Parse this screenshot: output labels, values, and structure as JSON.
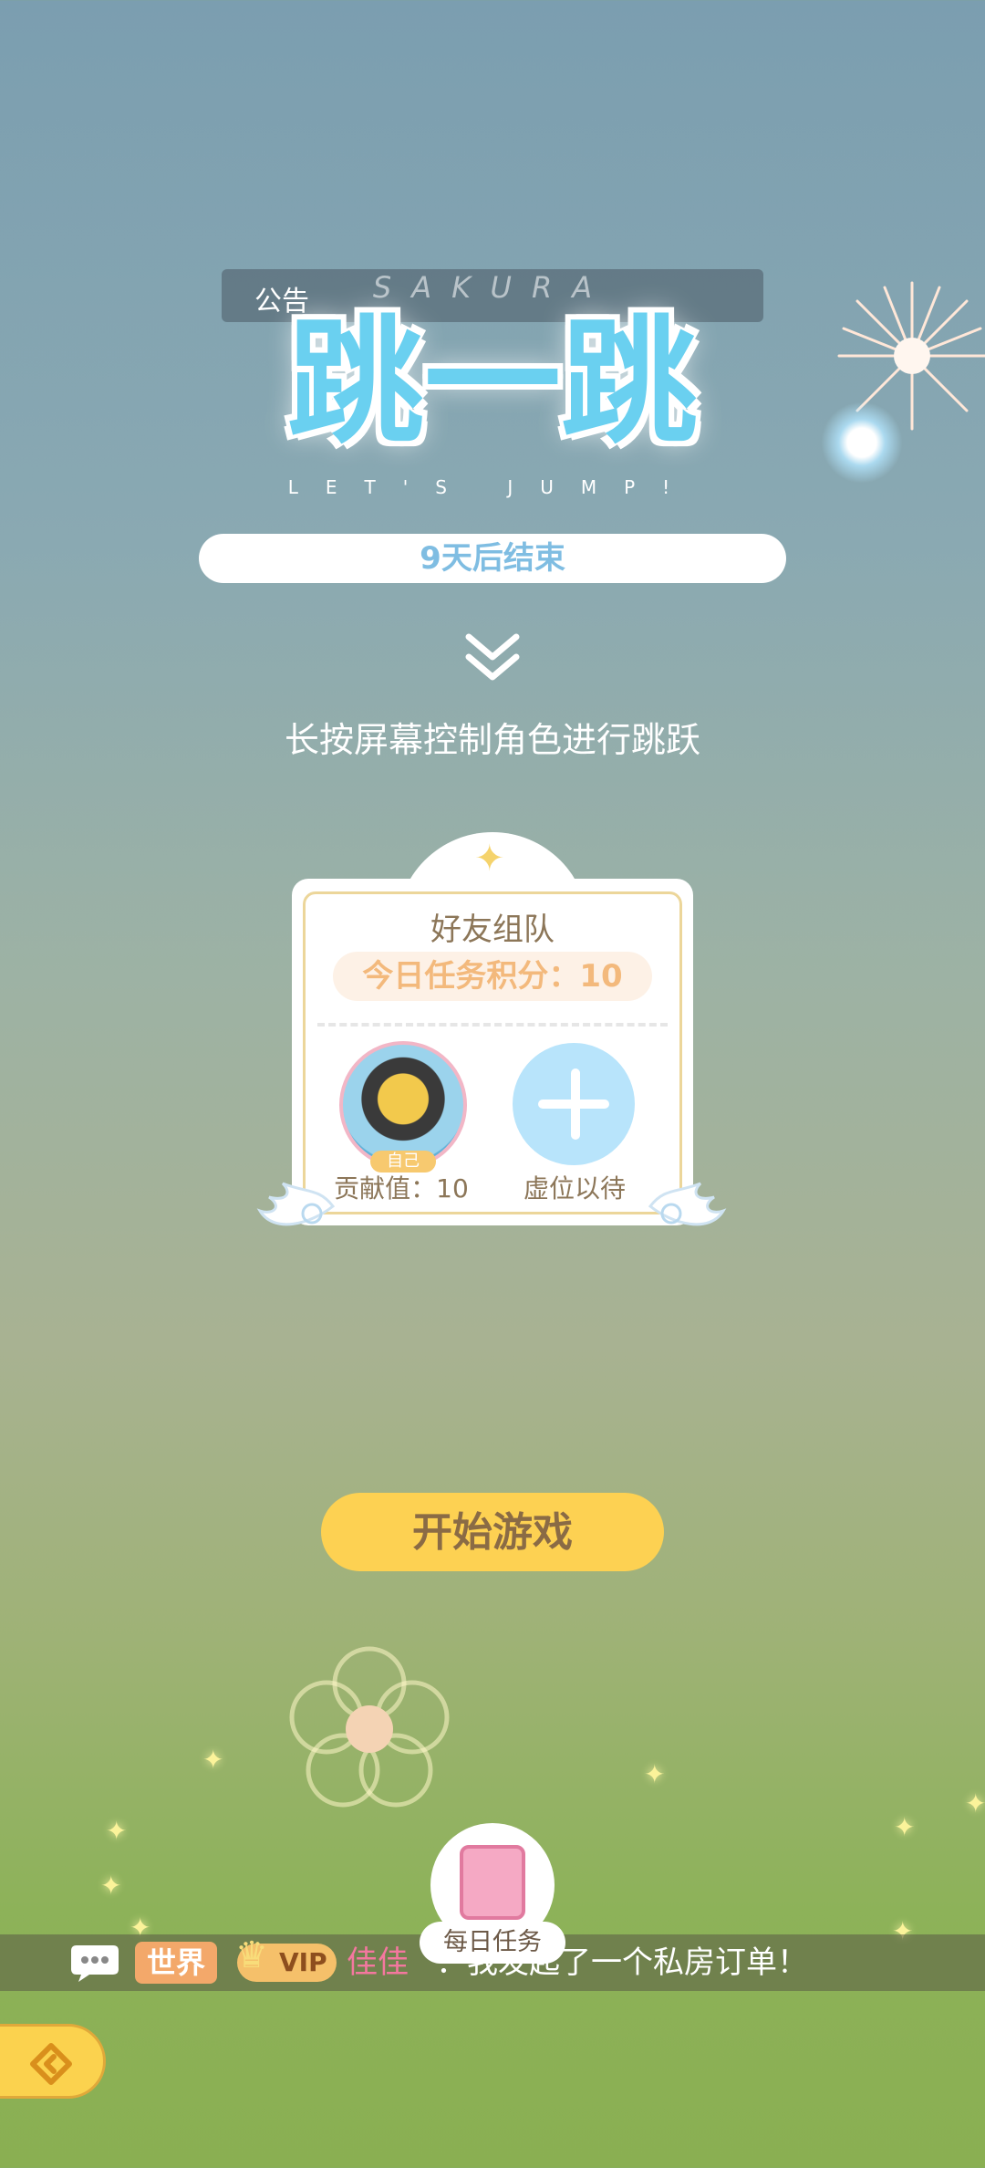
{
  "notice": {
    "label": "公告"
  },
  "logo": {
    "top_text": "SAKURA",
    "title": "跳一跳",
    "subtitle": "LET'S JUMP!"
  },
  "countdown": {
    "text": "9天后结束"
  },
  "hint": "长按屏幕控制角色进行跳跃",
  "team_card": {
    "title": "好友组队",
    "points_text": "今日任务积分：10",
    "self_tag": "自己",
    "self_contribution": "贡献值：10",
    "slot_waiting": "虚位以待"
  },
  "start_button": "开始游戏",
  "daily_task": {
    "label": "每日任务"
  },
  "chat": {
    "channel": "世界",
    "vip": "VIP",
    "user": "佳佳",
    "message": "：我发起了一个私房订单！"
  },
  "colors": {
    "start_button": "#fdd152",
    "add_button": "#b8e4fb",
    "chat_channel": "#f3a86a",
    "chat_user": "#f4779f"
  }
}
